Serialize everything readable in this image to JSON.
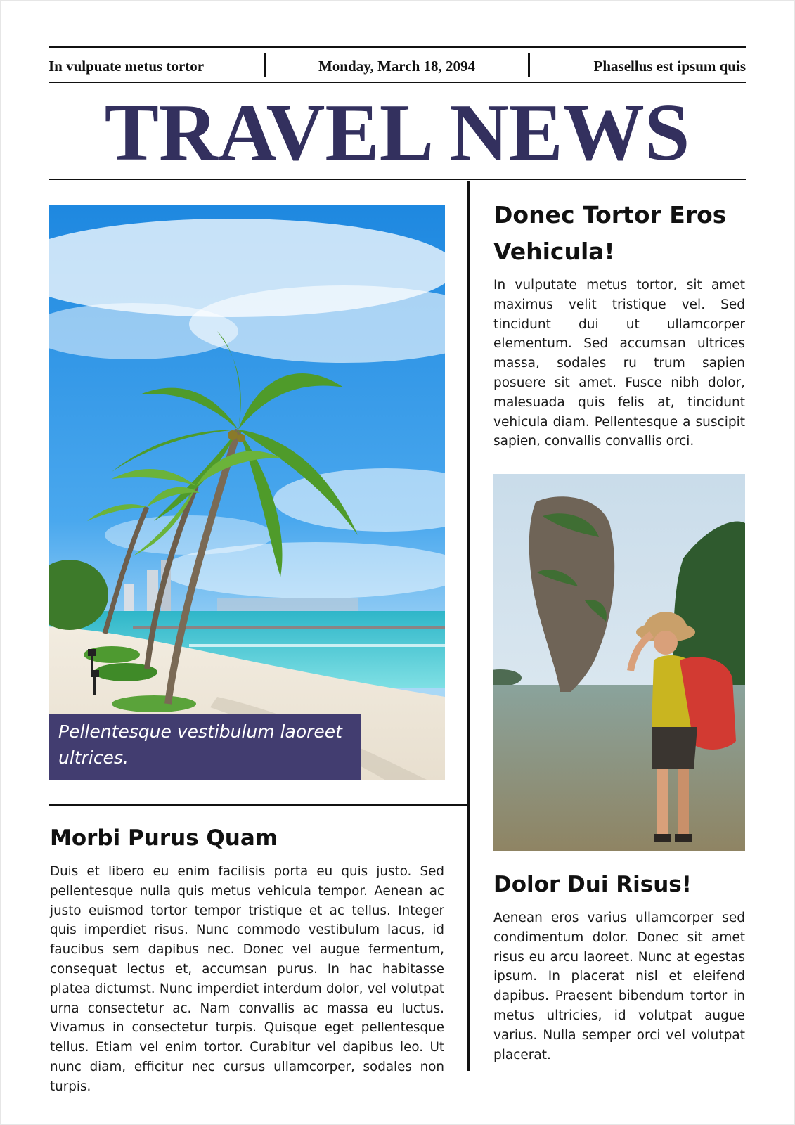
{
  "header": {
    "left_text": "In vulpuate metus tortor",
    "date": "Monday, March 18, 2094",
    "right_text": "Phasellus est ipsum quis"
  },
  "masthead": {
    "title": "TRAVEL NEWS"
  },
  "colors": {
    "brand": "#33305e",
    "caption_bg": "#423d70"
  },
  "main_image": {
    "caption": "Pellentesque vestibulum laoreet ultrices."
  },
  "article_left": {
    "heading": "Morbi Purus Quam",
    "body": "Duis et libero eu enim facilisis porta eu quis justo. Sed pellentesque nulla quis metus vehicula tempor. Aenean ac justo euismod tortor tempor tristique et ac tellus. Integer quis imperdiet risus. Nunc commodo vestibulum lacus, id faucibus sem dapibus nec. Donec vel augue fermentum, consequat lectus et, accumsan purus. In hac habitasse platea dictumst. Nunc imperdiet interdum dolor, vel volutpat urna consectetur ac. Nam convallis ac massa eu luctus. Vivamus in consectetur turpis. Quisque eget pellentesque tellus. Etiam vel enim tortor. Curabitur vel dapibus leo. Ut nunc diam, efficitur nec cursus ullamcorper, sodales non turpis."
  },
  "article_right_top": {
    "heading": "Donec Tortor Eros Vehicula!",
    "body": "In vulputate metus tortor, sit amet maximus velit tristique vel. Sed tincidunt dui ut ullamcorper elementum. Sed accumsan ultrices massa, sodales ru trum sapien posuere sit amet. Fusce nibh dolor, malesuada quis felis at, tincidunt vehicula diam. Pellentesque a suscipit sapien, convallis convallis orci."
  },
  "article_right_bottom": {
    "heading": "Dolor Dui Risus!",
    "body": "Aenean eros varius ullamcorper sed condimentum dolor. Donec sit amet risus eu arcu laoreet. Nunc at egestas ipsum. In placerat nisl et eleifend dapibus. Praesent bibendum tortor in metus ultricies, id volutpat augue varius. Nulla semper orci vel volutpat placerat."
  }
}
